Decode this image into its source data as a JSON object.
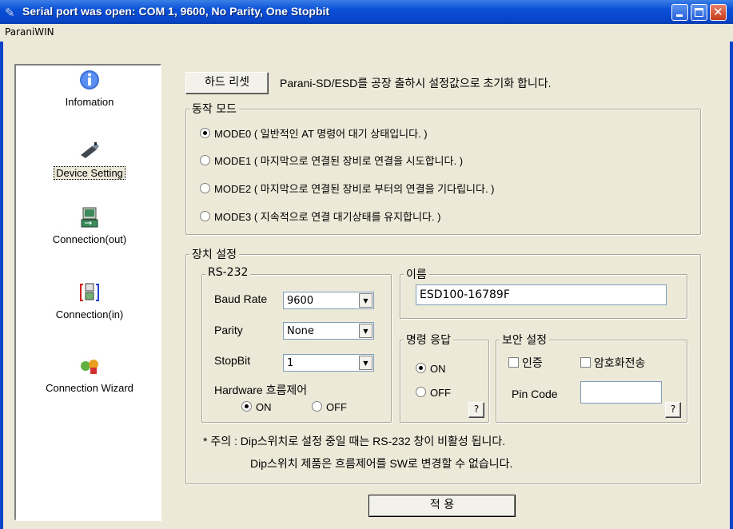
{
  "window": {
    "title": "Serial port was open: COM 1, 9600, No Parity, One Stopbit",
    "menu": "ParaniWIN"
  },
  "sidebar": {
    "items": [
      {
        "label": "Infomation",
        "icon": "info-icon"
      },
      {
        "label": "Device Setting",
        "icon": "device-icon",
        "selected": true
      },
      {
        "label": "Connection(out)",
        "icon": "connection-out-icon"
      },
      {
        "label": "Connection(in)",
        "icon": "connection-in-icon"
      },
      {
        "label": "Connection Wizard",
        "icon": "wizard-icon"
      }
    ]
  },
  "reset": {
    "button": "하드 리셋",
    "description": "Parani-SD/ESD를 공장 출하시 설정값으로 초기화 합니다."
  },
  "mode": {
    "title": "동작 모드",
    "options": [
      {
        "label": "MODE0 ( 일반적인 AT 명령어 대기 상태입니다. )",
        "checked": true
      },
      {
        "label": "MODE1 ( 마지막으로 연결된 장비로 연결을 시도합니다. )",
        "checked": false
      },
      {
        "label": "MODE2 ( 마지막으로 연결된 장비로 부터의 연결을 기다립니다. )",
        "checked": false
      },
      {
        "label": "MODE3 ( 지속적으로 연결 대기상태를 유지합니다. )",
        "checked": false
      }
    ]
  },
  "device": {
    "title": "장치 설정",
    "rs232": {
      "title": "RS-232",
      "baud_label": "Baud Rate",
      "baud_value": "9600",
      "parity_label": "Parity",
      "parity_value": "None",
      "stopbit_label": "StopBit",
      "stopbit_value": "1",
      "flow_label": "Hardware 흐름제어",
      "flow_on": "ON",
      "flow_off": "OFF"
    },
    "name": {
      "title": "이름",
      "value": "ESD100-16789F"
    },
    "response": {
      "title": "명령 응답",
      "on": "ON",
      "off": "OFF",
      "help": "?"
    },
    "security": {
      "title": "보안 설정",
      "auth": "인증",
      "encrypt": "암호화전송",
      "pin_label": "Pin Code",
      "pin_value": "",
      "help": "?"
    },
    "note1": "* 주의 : Dip스위치로 설정 중일 때는 RS-232 창이 비활성 됩니다.",
    "note2": "Dip스위치 제품은 흐름제어를 SW로 변경할 수 없습니다."
  },
  "apply_button": "적 용"
}
